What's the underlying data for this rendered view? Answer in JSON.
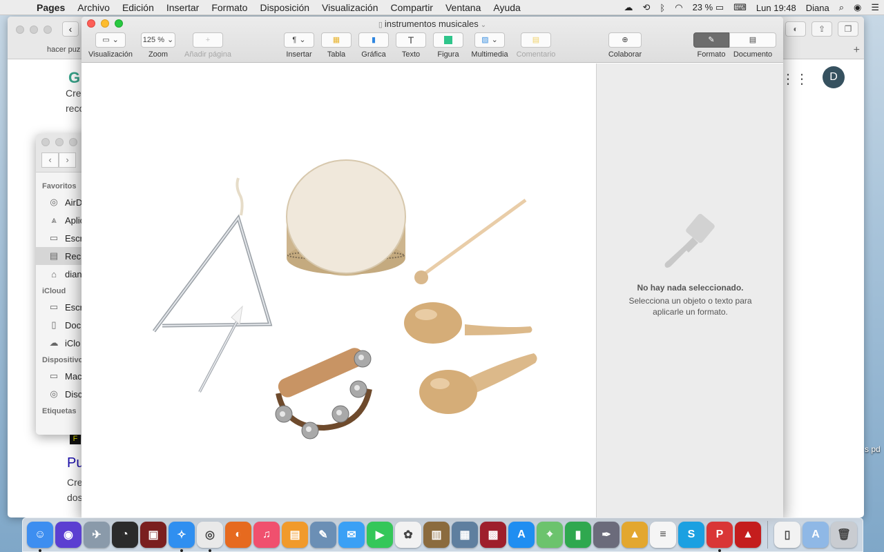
{
  "menubar": {
    "app_name": "Pages",
    "menus": [
      "Archivo",
      "Edición",
      "Insertar",
      "Formato",
      "Disposición",
      "Visualización",
      "Compartir",
      "Ventana",
      "Ayuda"
    ],
    "battery": "23 %",
    "clock": "Lun 19:48",
    "user": "Diana"
  },
  "browser": {
    "tab_label": "hacer puz",
    "left_text_1": "Cre",
    "left_text_2": "reco",
    "avatar_letter": "D",
    "result_title": "Pu",
    "result_desc_1": "Cre",
    "result_desc_2": "dos"
  },
  "desktop_label": "s pd",
  "finder": {
    "sections": {
      "favorites": "Favoritos",
      "icloud": "iCloud",
      "devices": "Dispositivo",
      "tags": "Etiquetas"
    },
    "favorites": [
      "AirD",
      "Aplic",
      "Escr",
      "Reci",
      "dian"
    ],
    "icloud": [
      "Escr",
      "Doc",
      "iClo"
    ],
    "devices": [
      "Mac",
      "Disc"
    ]
  },
  "pages": {
    "document_title": "instrumentos musicales",
    "toolbar": {
      "view": "Visualización",
      "zoom_value": "125 %",
      "zoom": "Zoom",
      "add_page": "Añadir página",
      "insert": "Insertar",
      "table": "Tabla",
      "chart": "Gráfica",
      "text": "Texto",
      "shape": "Figura",
      "media": "Multimedia",
      "comment": "Comentario",
      "collaborate": "Colaborar",
      "format": "Formato",
      "document": "Documento"
    },
    "inspector": {
      "empty_title": "No hay nada seleccionado.",
      "empty_body": "Selecciona un objeto o texto para aplicarle un formato."
    }
  },
  "dock": {
    "apps": [
      {
        "name": "finder",
        "color": "#3d8ef0",
        "glyph": "☺",
        "running": true
      },
      {
        "name": "siri",
        "color": "#5b3fd1",
        "glyph": "◉",
        "running": false
      },
      {
        "name": "launchpad",
        "color": "#8a9aaa",
        "glyph": "✈",
        "running": false
      },
      {
        "name": "dashboard",
        "color": "#2b2b2b",
        "glyph": "◔",
        "running": false
      },
      {
        "name": "photo-booth",
        "color": "#7a1f1f",
        "glyph": "▣",
        "running": false
      },
      {
        "name": "safari",
        "color": "#2f8ff0",
        "glyph": "✧",
        "running": true
      },
      {
        "name": "chrome",
        "color": "#e9e9e9",
        "glyph": "◎",
        "running": true
      },
      {
        "name": "firefox",
        "color": "#e66a1f",
        "glyph": "◐",
        "running": false
      },
      {
        "name": "music",
        "color": "#f0506e",
        "glyph": "♫",
        "running": false
      },
      {
        "name": "books",
        "color": "#f19a2b",
        "glyph": "▤",
        "running": false
      },
      {
        "name": "preview",
        "color": "#6b8fb5",
        "glyph": "✎",
        "running": false
      },
      {
        "name": "messages",
        "color": "#3aa0f5",
        "glyph": "✉",
        "running": false
      },
      {
        "name": "facetime",
        "color": "#34c759",
        "glyph": "▶",
        "running": false
      },
      {
        "name": "photos",
        "color": "#f2f2f2",
        "glyph": "✿",
        "running": false
      },
      {
        "name": "notefile",
        "color": "#8b6b3e",
        "glyph": "▥",
        "running": false
      },
      {
        "name": "image-capture",
        "color": "#5f7f9f",
        "glyph": "▦",
        "running": false
      },
      {
        "name": "photo-app",
        "color": "#9e1f2c",
        "glyph": "▩",
        "running": false
      },
      {
        "name": "app-store",
        "color": "#1f8ef1",
        "glyph": "A",
        "running": false
      },
      {
        "name": "maps",
        "color": "#6cc36d",
        "glyph": "⌖",
        "running": false
      },
      {
        "name": "numbers",
        "color": "#2fa84f",
        "glyph": "▮",
        "running": false
      },
      {
        "name": "script-editor",
        "color": "#6b6b7b",
        "glyph": "✒",
        "running": false
      },
      {
        "name": "keynote",
        "color": "#e3a72f",
        "glyph": "▲",
        "running": false
      },
      {
        "name": "textedit",
        "color": "#f5f5f5",
        "glyph": "≡",
        "running": false
      },
      {
        "name": "skype",
        "color": "#1ba0e1",
        "glyph": "S",
        "running": false
      },
      {
        "name": "pdf-app",
        "color": "#d93636",
        "glyph": "P",
        "running": true
      },
      {
        "name": "acrobat",
        "color": "#c41d1d",
        "glyph": "▲",
        "running": false
      },
      {
        "name": "document-file",
        "color": "#f2f2f2",
        "glyph": "▯",
        "running": false
      },
      {
        "name": "downloads-folder",
        "color": "#8fb8e6",
        "glyph": "A",
        "running": false
      },
      {
        "name": "trash",
        "color": "#c9ccd1",
        "glyph": "🗑",
        "running": false
      }
    ]
  }
}
